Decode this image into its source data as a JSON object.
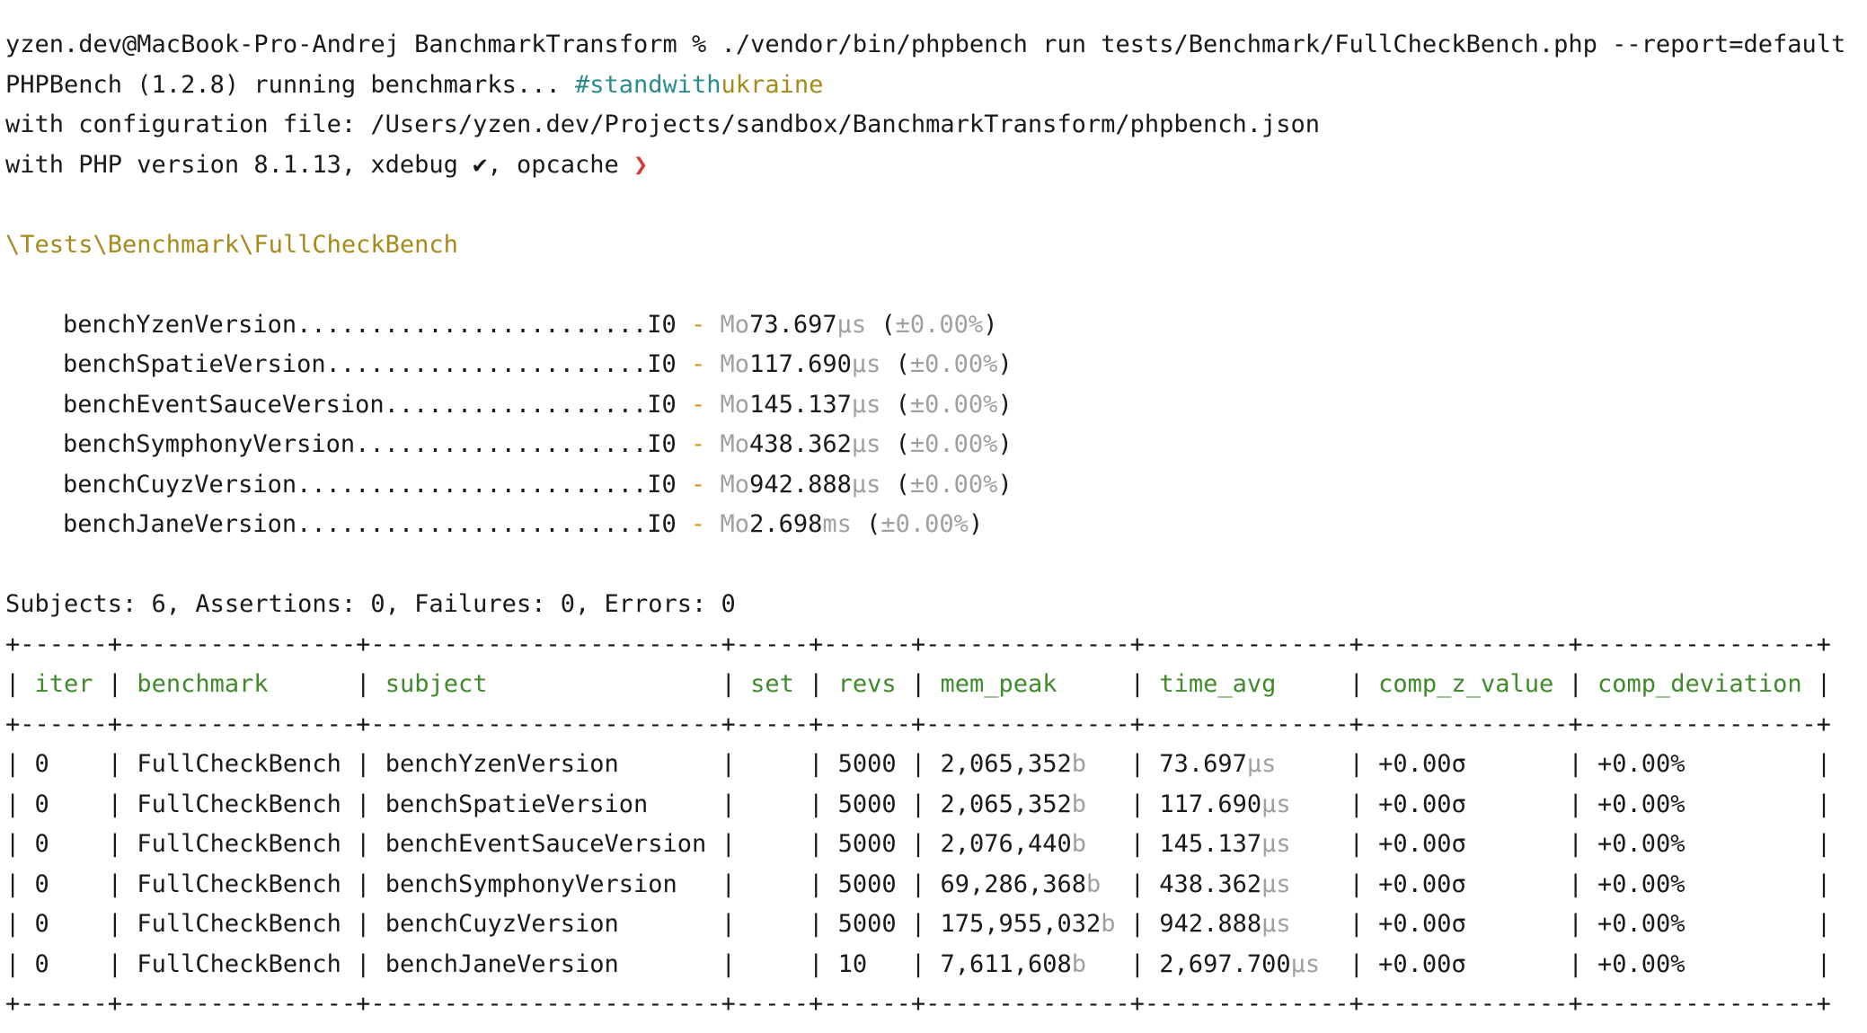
{
  "terminal": {
    "prompt_user_host": "yzen.dev@MacBook-Pro-Andrej",
    "prompt_dir": "BanchmarkTransform",
    "prompt_symbol": "%",
    "command": "./vendor/bin/phpbench run tests/Benchmark/FullCheckBench.php --report=default",
    "phpbench_line": "PHPBench (1.2.8) running benchmarks...",
    "hashtag_a": "#standwith",
    "hashtag_b": "ukraine",
    "config_line": "with configuration file: /Users/yzen.dev/Projects/sandbox/BanchmarkTransform/phpbench.json",
    "php_line": "with PHP version 8.1.13, xdebug ✔, opcache",
    "opcache_mark": "❯",
    "bench_class": "\\Tests\\Benchmark\\FullCheckBench",
    "bench_results": [
      {
        "name": "benchYzenVersion",
        "dots": "........................",
        "iter_tag": "I0",
        "sep": "-",
        "mode": "Mo",
        "value": "73.697",
        "unit": "μs",
        "dev_open": "(",
        "dev": "±0.00%",
        "dev_close": ")"
      },
      {
        "name": "benchSpatieVersion",
        "dots": "......................",
        "iter_tag": "I0",
        "sep": "-",
        "mode": "Mo",
        "value": "117.690",
        "unit": "μs",
        "dev_open": "(",
        "dev": "±0.00%",
        "dev_close": ")"
      },
      {
        "name": "benchEventSauceVersion",
        "dots": "..................",
        "iter_tag": "I0",
        "sep": "-",
        "mode": "Mo",
        "value": "145.137",
        "unit": "μs",
        "dev_open": "(",
        "dev": "±0.00%",
        "dev_close": ")"
      },
      {
        "name": "benchSymphonyVersion",
        "dots": "....................",
        "iter_tag": "I0",
        "sep": "-",
        "mode": "Mo",
        "value": "438.362",
        "unit": "μs",
        "dev_open": "(",
        "dev": "±0.00%",
        "dev_close": ")"
      },
      {
        "name": "benchCuyzVersion",
        "dots": "........................",
        "iter_tag": "I0",
        "sep": "-",
        "mode": "Mo",
        "value": "942.888",
        "unit": "μs",
        "dev_open": "(",
        "dev": "±0.00%",
        "dev_close": ")"
      },
      {
        "name": "benchJaneVersion",
        "dots": "........................",
        "iter_tag": "I0",
        "sep": "-",
        "mode": "Mo",
        "value": "2.698",
        "unit": "ms",
        "dev_open": "(",
        "dev": "±0.00%",
        "dev_close": ")"
      }
    ],
    "summary": "Subjects: 6, Assertions: 0, Failures: 0, Errors: 0",
    "table": {
      "border": "+------+----------------+------------------------+-----+------+--------------+--------------+--------------+----------------+",
      "headers": [
        "iter",
        "benchmark",
        "subject",
        "set",
        "revs",
        "mem_peak",
        "time_avg",
        "comp_z_value",
        "comp_deviation"
      ],
      "rows": [
        {
          "iter": "0",
          "benchmark": "FullCheckBench",
          "subject": "benchYzenVersion",
          "set": "",
          "revs": "5000",
          "mem_peak": "2,065,352",
          "mem_unit": "b",
          "time_avg": "73.697",
          "time_unit": "μs",
          "comp_z_value": "+0.00σ",
          "comp_deviation": "+0.00%"
        },
        {
          "iter": "0",
          "benchmark": "FullCheckBench",
          "subject": "benchSpatieVersion",
          "set": "",
          "revs": "5000",
          "mem_peak": "2,065,352",
          "mem_unit": "b",
          "time_avg": "117.690",
          "time_unit": "μs",
          "comp_z_value": "+0.00σ",
          "comp_deviation": "+0.00%"
        },
        {
          "iter": "0",
          "benchmark": "FullCheckBench",
          "subject": "benchEventSauceVersion",
          "set": "",
          "revs": "5000",
          "mem_peak": "2,076,440",
          "mem_unit": "b",
          "time_avg": "145.137",
          "time_unit": "μs",
          "comp_z_value": "+0.00σ",
          "comp_deviation": "+0.00%"
        },
        {
          "iter": "0",
          "benchmark": "FullCheckBench",
          "subject": "benchSymphonyVersion",
          "set": "",
          "revs": "5000",
          "mem_peak": "69,286,368",
          "mem_unit": "b",
          "time_avg": "438.362",
          "time_unit": "μs",
          "comp_z_value": "+0.00σ",
          "comp_deviation": "+0.00%"
        },
        {
          "iter": "0",
          "benchmark": "FullCheckBench",
          "subject": "benchCuyzVersion",
          "set": "",
          "revs": "5000",
          "mem_peak": "175,955,032",
          "mem_unit": "b",
          "time_avg": "942.888",
          "time_unit": "μs",
          "comp_z_value": "+0.00σ",
          "comp_deviation": "+0.00%"
        },
        {
          "iter": "0",
          "benchmark": "FullCheckBench",
          "subject": "benchJaneVersion",
          "set": "",
          "revs": "10",
          "mem_peak": "7,611,608",
          "mem_unit": "b",
          "time_avg": "2,697.700",
          "time_unit": "μs",
          "comp_z_value": "+0.00σ",
          "comp_deviation": "+0.00%"
        }
      ]
    },
    "colors": {
      "background": "#ffffff",
      "text": "#1a1a1a",
      "hashtag_teal": "#2a8d8d",
      "hashtag_gold": "#a68a1c",
      "class_name": "#a68a1c",
      "dash_orange": "#d8951a",
      "dim_units": "#a0a0a0",
      "opcache_red": "#d23c3c",
      "table_header_green": "#3f8a2a"
    }
  }
}
